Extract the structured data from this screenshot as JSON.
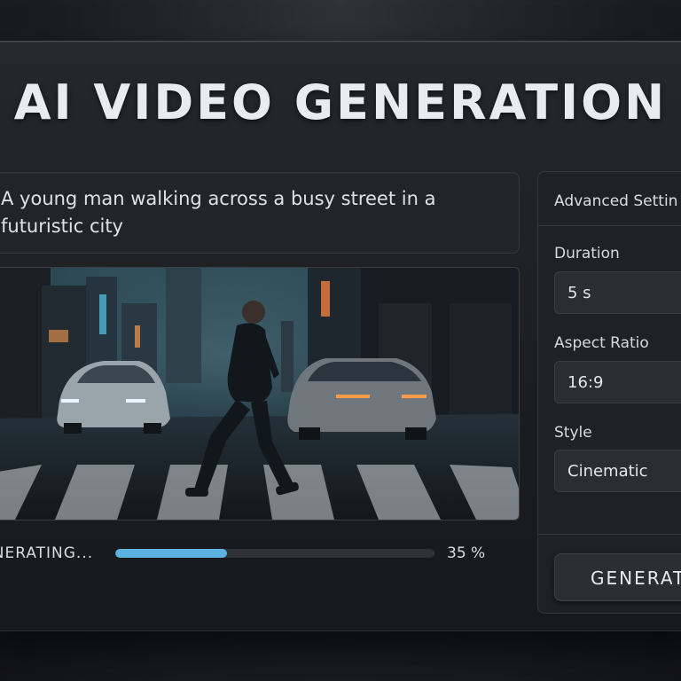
{
  "header": {
    "title": "AI VIDEO GENERATION"
  },
  "prompt": {
    "text": "A young man walking across a busy street in a futuristic city"
  },
  "video": {
    "description_icon": "video-preview"
  },
  "progress": {
    "label": "ENERATING...",
    "percent_text": "35 %",
    "value": 0.35
  },
  "settings": {
    "header": "Advanced Settin",
    "duration_label": "Duration",
    "duration_value": "5 s",
    "aspect_label": "Aspect Ratio",
    "aspect_value": "16:9",
    "style_label": "Style",
    "style_value": "Cinematic",
    "generate_button": "GENERAT"
  },
  "colors": {
    "accent": "#5bb4e0",
    "background": "#1c1e21"
  }
}
